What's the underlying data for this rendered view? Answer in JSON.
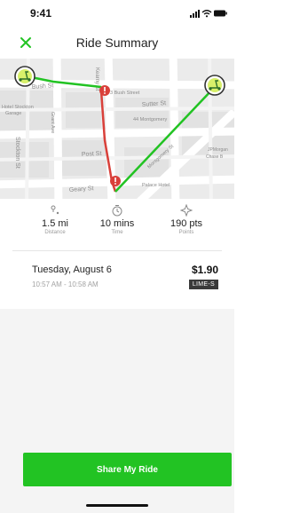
{
  "status_bar": {
    "time": "9:41"
  },
  "header": {
    "title": "Ride Summary",
    "close_icon": "x-icon"
  },
  "map": {
    "streets": [
      "Bush St",
      "Sutter St",
      "Post St",
      "Geary St",
      "Stockton St",
      "Grant Ave",
      "Montgomery St",
      "Kearny St"
    ],
    "places": [
      "Hotel Stockton",
      "Garage",
      "3 Bush Street",
      "44 Montgomery",
      "Palace Hotel",
      "JPMorgan",
      "Chase B"
    ],
    "colors": {
      "route_actual": "#22c323",
      "route_alt": "#d9403a",
      "marker_start": "#22c323"
    }
  },
  "stats": [
    {
      "icon": "location-pin-icon",
      "value": "1.5 mi",
      "label": "Distance"
    },
    {
      "icon": "clock-icon",
      "value": "10 mins",
      "label": "Time"
    },
    {
      "icon": "points-star-icon",
      "value": "190 pts",
      "label": "Points"
    }
  ],
  "trip": {
    "date": "Tuesday, August 6",
    "time_range": "10:57 AM - 10:58 AM",
    "price": "$1.90",
    "vehicle_badge": "LIME-S"
  },
  "share_button": {
    "label": "Share My Ride"
  }
}
